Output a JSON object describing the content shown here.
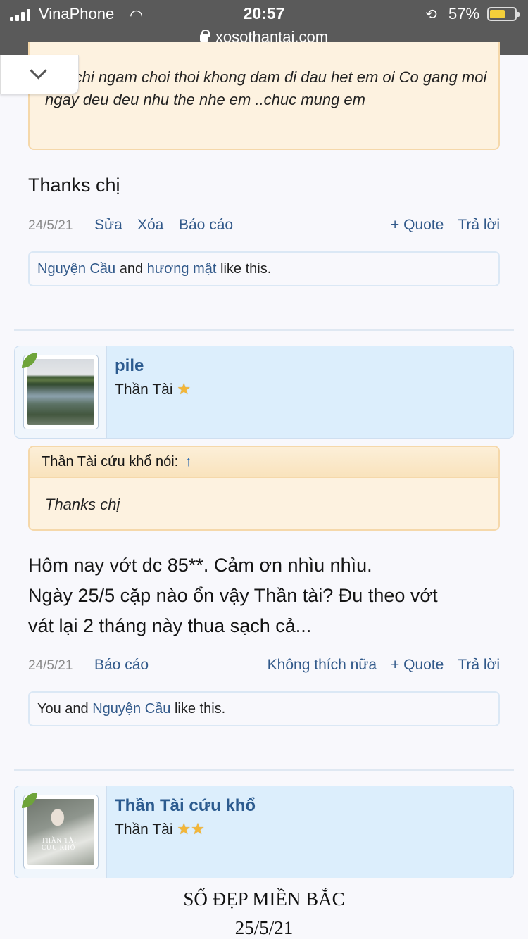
{
  "status_bar": {
    "carrier": "VinaPhone",
    "time": "20:57",
    "battery": "57%",
    "battery_level": 0.57,
    "icons": [
      "signal-icon",
      "wifi-icon",
      "rotation-lock-icon",
      "battery-icon"
    ]
  },
  "url_bar": {
    "domain": "xosothantai.com",
    "icon": "lock-icon"
  },
  "thread": {
    "quote_top": {
      "text": "nay chi ngam choi thoi khong dam di dau het em oi Co gang moi ngay deu deu nhu the nhe em ..chuc mung em"
    },
    "post1": {
      "message": "Thanks chị",
      "date": "24/5/21",
      "actions": {
        "edit": "Sửa",
        "delete": "Xóa",
        "report": "Báo cáo",
        "quote": "+ Quote",
        "reply": "Trả lời"
      },
      "likes": {
        "user1": "Nguyện Cầu",
        "and": " and ",
        "user2": "hương mật",
        "suffix": " like this."
      }
    },
    "post2": {
      "author": {
        "name": "pile",
        "title": "Thần Tài",
        "stars": "★"
      },
      "quote": {
        "header": "Thần Tài cứu khổ nói:",
        "arrow": "↑",
        "text": "Thanks chị"
      },
      "message_lines": [
        "Hôm nay vớt dc 85**. Cảm ơn nhìu nhìu.",
        "Ngày 25/5 cặp nào ổn vậy Thần tài? Đu theo vớt",
        "vát lại 2 tháng này thua sạch cả..."
      ],
      "date": "24/5/21",
      "actions": {
        "report": "Báo cáo",
        "unlike": "Không thích nữa",
        "quote": "+ Quote",
        "reply": "Trả lời"
      },
      "likes": {
        "prefix": "You and ",
        "user1": "Nguyện Cầu",
        "suffix": " like this."
      }
    },
    "post3": {
      "author": {
        "name": "Thần Tài cứu khổ",
        "title": "Thần Tài",
        "stars": "★★"
      },
      "avatar_caption": "THẦN TÀI CỨU KHỔ",
      "message_lines": [
        "SỐ ĐẸP MIỀN BẮC",
        "25/5/21"
      ]
    }
  }
}
